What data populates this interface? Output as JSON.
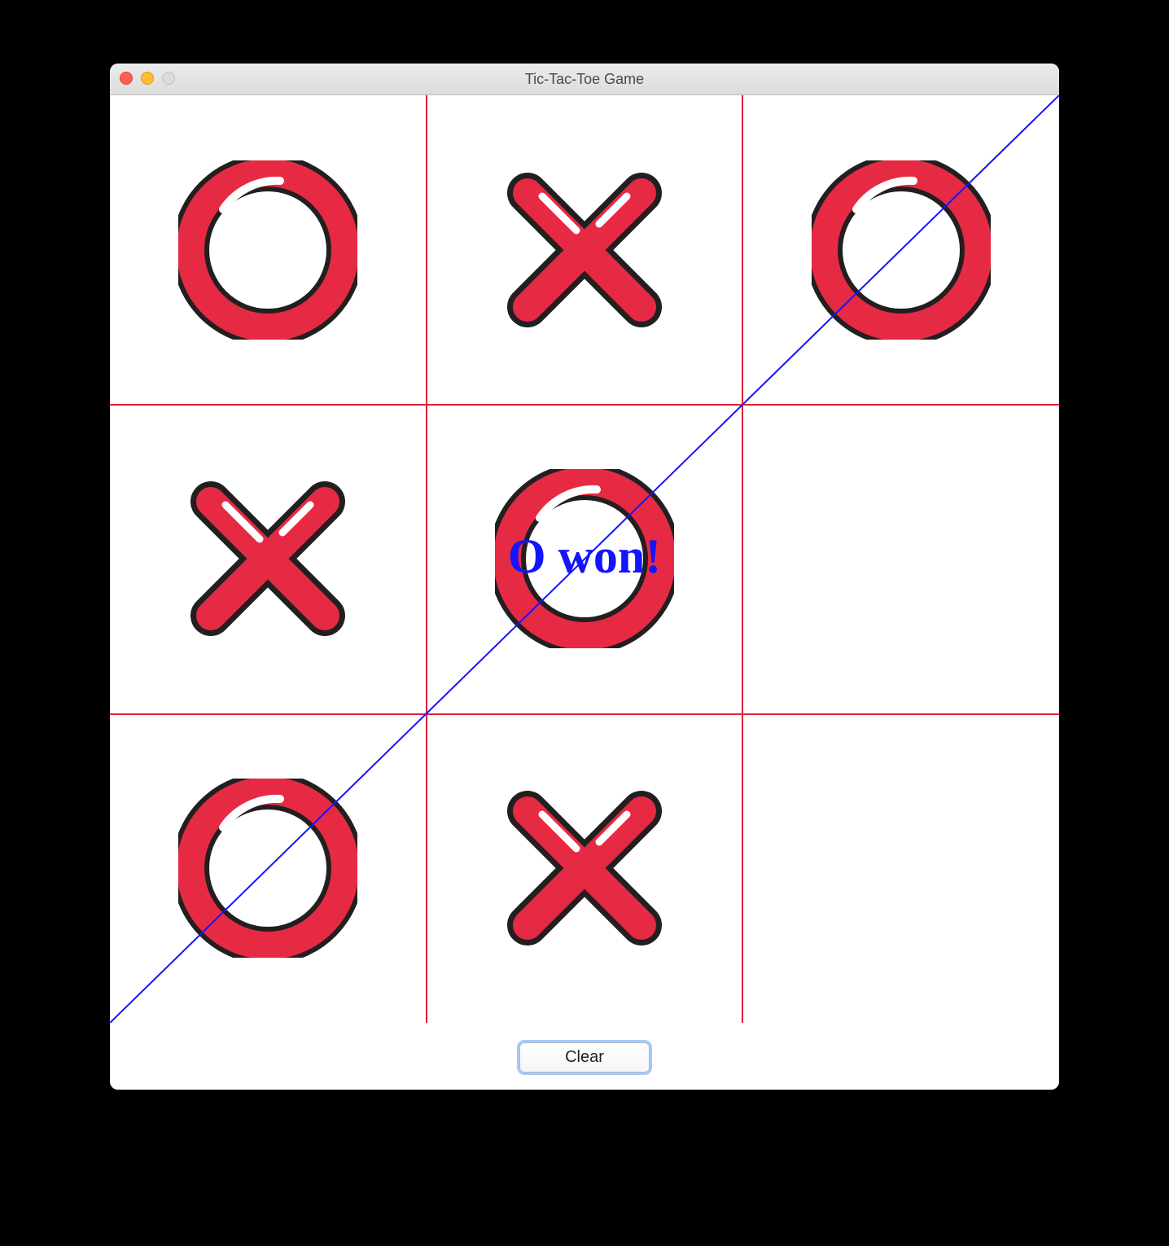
{
  "window": {
    "title": "Tic-Tac-Toe Game"
  },
  "game": {
    "status_text": "O won!",
    "clear_label": "Clear",
    "win_line": "anti-diagonal",
    "board": [
      [
        "O",
        "X",
        "O"
      ],
      [
        "X",
        "O",
        ""
      ],
      [
        "O",
        "X",
        ""
      ]
    ]
  },
  "colors": {
    "grid": "#e0213b",
    "piece_fill": "#e62a44",
    "piece_outline": "#231f20",
    "piece_highlight": "#ffffff",
    "win_line": "#1414ff",
    "status_text": "#1414ff"
  }
}
